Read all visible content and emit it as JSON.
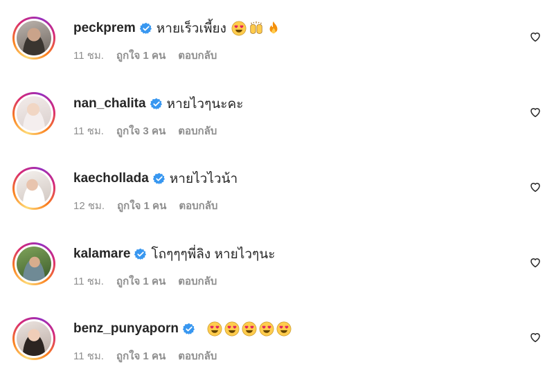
{
  "comments": [
    {
      "username": "peckprem",
      "text": "หายเร็วเพี้ยง",
      "emojis": [
        "heart-eyes-face-icon",
        "raised-hands-icon",
        "fire-icon"
      ],
      "time": "11 ชม.",
      "likes": "ถูกใจ 1 คน",
      "reply": "ตอบกลับ"
    },
    {
      "username": "nan_chalita",
      "text": "หายไวๆนะคะ",
      "emojis": [],
      "time": "11 ชม.",
      "likes": "ถูกใจ 3 คน",
      "reply": "ตอบกลับ"
    },
    {
      "username": "kaechollada",
      "text": "หายไวไวน้า",
      "emojis": [],
      "time": "12 ชม.",
      "likes": "ถูกใจ 1 คน",
      "reply": "ตอบกลับ"
    },
    {
      "username": "kalamare",
      "text": "โถๆๆๆพี่ลิง หายไวๆนะ",
      "emojis": [],
      "time": "11 ชม.",
      "likes": "ถูกใจ 1 คน",
      "reply": "ตอบกลับ"
    },
    {
      "username": "benz_punyaporn",
      "text": "",
      "emojis": [
        "heart-eyes-face-icon",
        "heart-eyes-face-icon",
        "heart-eyes-face-icon",
        "heart-eyes-face-icon",
        "heart-eyes-face-icon"
      ],
      "time": "11 ชม.",
      "likes": "ถูกใจ 1 คน",
      "reply": "ตอบกลับ"
    }
  ],
  "colors": {
    "verified": "#3897f0",
    "secondary_text": "#8e8e8e",
    "primary_text": "#262626"
  }
}
